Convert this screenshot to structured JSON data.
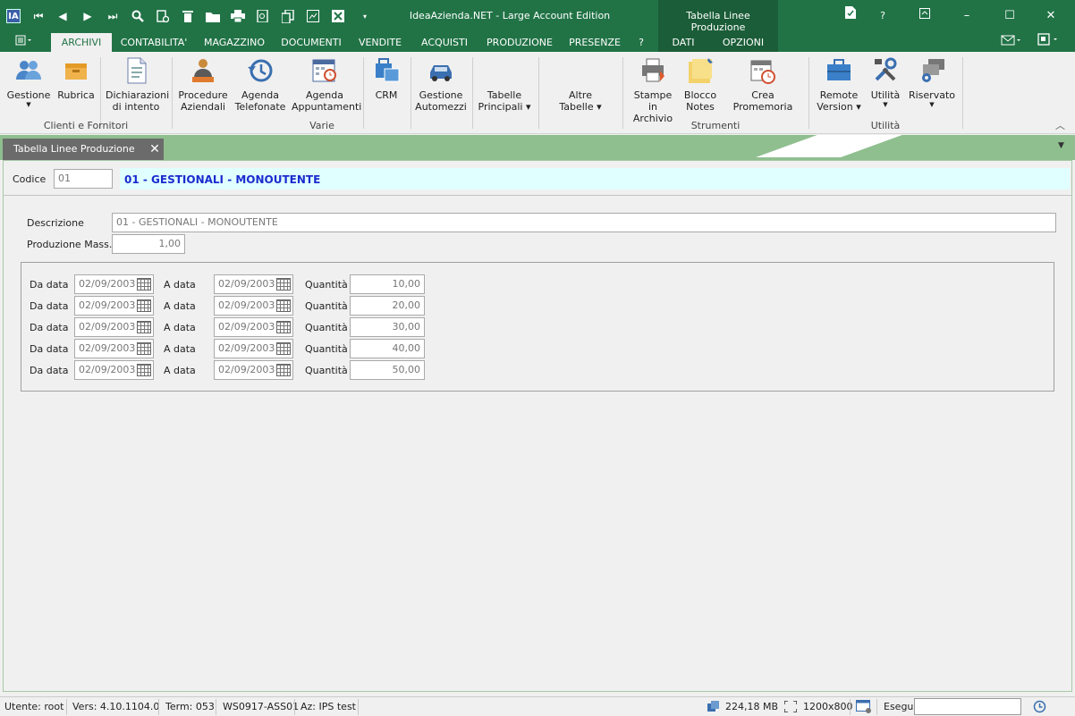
{
  "window": {
    "title": "IdeaAzienda.NET - Large Account Edition",
    "context_tab_title": "Tabella Linee Produzione",
    "logo_text": "IA"
  },
  "quick_access": {
    "icons": [
      "first-record-icon",
      "prev-record-icon",
      "next-record-icon",
      "last-record-icon",
      "search-icon",
      "new-record-icon",
      "delete-icon",
      "open-folder-icon",
      "print-icon",
      "print-preview-icon",
      "copy-icon",
      "attach-icon",
      "cancel-icon",
      "customize-dropdown-icon"
    ]
  },
  "window_controls": {
    "document_icon": "document-icon",
    "help": "?",
    "restore_ribbon": "restore-ribbon-icon",
    "minimize": "–",
    "maximize": "☐",
    "close": "✕"
  },
  "ribbon_tabs": [
    {
      "label": "ARCHIVI",
      "active": true
    },
    {
      "label": "CONTABILITA'"
    },
    {
      "label": "MAGAZZINO"
    },
    {
      "label": "DOCUMENTI"
    },
    {
      "label": "VENDITE"
    },
    {
      "label": "ACQUISTI"
    },
    {
      "label": "PRODUZIONE"
    },
    {
      "label": "PRESENZE"
    },
    {
      "label": "?"
    },
    {
      "label": "DATI"
    },
    {
      "label": "OPZIONI"
    }
  ],
  "ribbon": {
    "buttons": [
      {
        "line1": "Gestione",
        "line2": "",
        "dropdown": true
      },
      {
        "line1": "Rubrica",
        "line2": ""
      },
      {
        "line1": "Dichiarazioni",
        "line2": "di intento"
      },
      {
        "line1": "Procedure",
        "line2": "Aziendali"
      },
      {
        "line1": "Agenda",
        "line2": "Telefonate"
      },
      {
        "line1": "Agenda",
        "line2": "Appuntamenti"
      },
      {
        "line1": "CRM",
        "line2": ""
      },
      {
        "line1": "Gestione",
        "line2": "Automezzi"
      },
      {
        "line1": "Tabelle",
        "line2": "Principali ▾"
      },
      {
        "line1": "Altre",
        "line2": "Tabelle ▾"
      },
      {
        "line1": "Stampe in",
        "line2": "Archivio"
      },
      {
        "line1": "Blocco",
        "line2": "Notes"
      },
      {
        "line1": "Crea Promemoria",
        "line2": ""
      },
      {
        "line1": "Remote",
        "line2": "Version ▾"
      },
      {
        "line1": "Utilità",
        "line2": "",
        "dropdown": true
      },
      {
        "line1": "Riservato",
        "line2": "",
        "dropdown": true
      }
    ],
    "groups": [
      "Clienti e Fornitori",
      "Varie",
      "Strumenti",
      "Utilità"
    ],
    "collapse_glyph": "︿"
  },
  "document_tab": {
    "label": "Tabella Linee Produzione",
    "close": "✕",
    "menu_glyph": "▼"
  },
  "form": {
    "codice_label": "Codice",
    "codice_value": "01",
    "title": "01 - GESTIONALI - MONOUTENTE",
    "descrizione_label": "Descrizione",
    "descrizione_value": "01 - GESTIONALI - MONOUTENTE",
    "produzione_label": "Produzione Mass.",
    "produzione_value": "1,00",
    "periods": [
      {
        "da_label": "Da data",
        "da": "02/09/2003",
        "a_label": "A data",
        "a": "02/09/2003",
        "q_label": "Quantità",
        "q": "10,00"
      },
      {
        "da_label": "Da data",
        "da": "02/09/2003",
        "a_label": "A data",
        "a": "02/09/2003",
        "q_label": "Quantità",
        "q": "20,00"
      },
      {
        "da_label": "Da data",
        "da": "02/09/2003",
        "a_label": "A data",
        "a": "02/09/2003",
        "q_label": "Quantità",
        "q": "30,00"
      },
      {
        "da_label": "Da data",
        "da": "02/09/2003",
        "a_label": "A data",
        "a": "02/09/2003",
        "q_label": "Quantità",
        "q": "40,00"
      },
      {
        "da_label": "Da data",
        "da": "02/09/2003",
        "a_label": "A data",
        "a": "02/09/2003",
        "q_label": "Quantità",
        "q": "50,00"
      }
    ]
  },
  "status": {
    "utente": "Utente: root",
    "versione": "Vers: 4.10.1104.0",
    "terminale": "Term: 053",
    "workstation": "WS0917-ASS01",
    "azienda": "Az: IPS test",
    "memoria": "224,18 MB",
    "risoluzione": "1200x800",
    "esegui_label": "Esegui",
    "esegui_value": ""
  }
}
